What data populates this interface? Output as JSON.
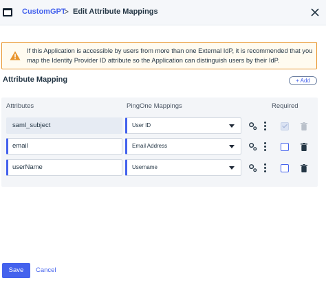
{
  "header": {
    "app_name": "CustomGPT",
    "separator": ">",
    "page_title": "Edit Attribute Mappings",
    "close_icon": "close-icon"
  },
  "warning": {
    "icon": "warning-triangle-icon",
    "text": "If this Application is accessible by users from more than one External IdP, it is recommended that you map the Identity Provider ID attribute so the Application can distinguish users by their IdP.",
    "border_color": "#e8952d"
  },
  "section": {
    "title": "Attribute Mapping",
    "add_label": "+ Add"
  },
  "table": {
    "headers": {
      "attributes": "Attributes",
      "mappings": "PingOne Mappings",
      "required": "Required"
    },
    "rows": [
      {
        "attribute": "saml_subject",
        "mapping": "User ID",
        "required": true,
        "locked": true
      },
      {
        "attribute": "email",
        "mapping": "Email Address",
        "required": false,
        "locked": false
      },
      {
        "attribute": "userName",
        "mapping": "Username",
        "required": false,
        "locked": false
      }
    ]
  },
  "footer": {
    "save_label": "Save",
    "cancel_label": "Cancel"
  },
  "colors": {
    "accent": "#4462ed",
    "text": "#253746"
  }
}
